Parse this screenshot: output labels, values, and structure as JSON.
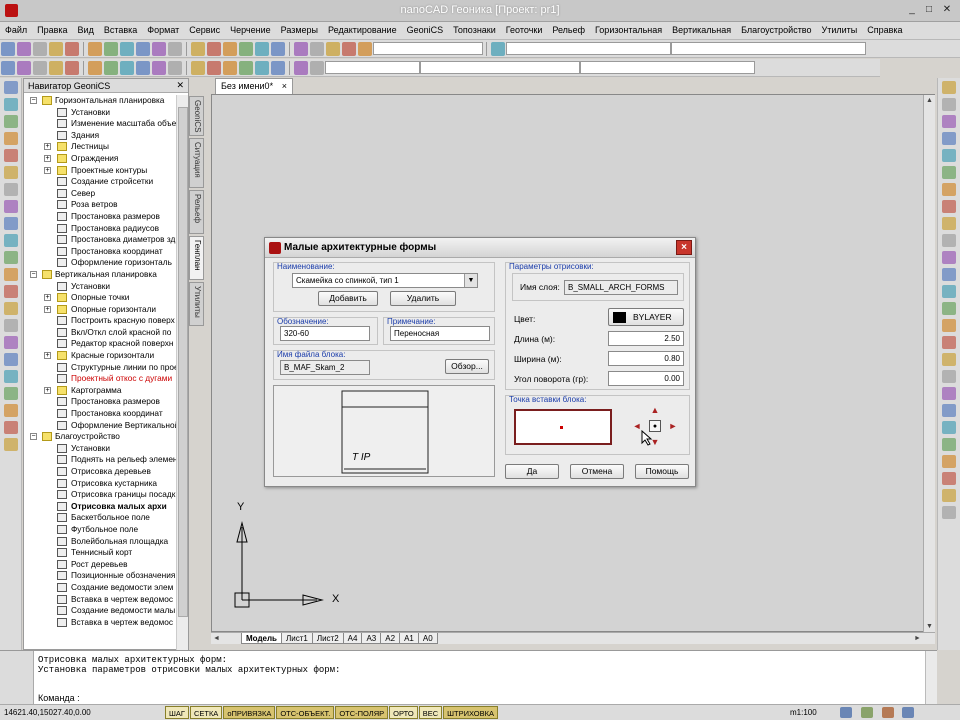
{
  "window": {
    "title": "nanoCAD Геоника [Проект: pr1]"
  },
  "menu": [
    "Файл",
    "Правка",
    "Вид",
    "Вставка",
    "Формат",
    "Сервис",
    "Черчение",
    "Размеры",
    "Редактирование",
    "GeoniCS",
    "Топознаки",
    "Геоточки",
    "Рельеф",
    "Горизонтальная",
    "Вертикальная",
    "Благоустройство",
    "Утилиты",
    "Справка"
  ],
  "navigator": {
    "title": "Навигатор GeoniCS",
    "items": [
      {
        "label": "Горизонтальная планировка",
        "level": 0,
        "expander": "−",
        "icon": "folder-icon"
      },
      {
        "label": "Установки",
        "level": 1,
        "icon": "settings-icon"
      },
      {
        "label": "Изменение масштаба объе",
        "level": 1,
        "icon": "scale-icon"
      },
      {
        "label": "Здания",
        "level": 1,
        "icon": "building-icon"
      },
      {
        "label": "Лестницы",
        "level": 1,
        "expander": "+",
        "icon": "folder-icon"
      },
      {
        "label": "Ограждения",
        "level": 1,
        "expander": "+",
        "icon": "folder-icon"
      },
      {
        "label": "Проектные контуры",
        "level": 1,
        "expander": "+",
        "icon": "folder-icon"
      },
      {
        "label": "Создание стройсетки",
        "level": 1,
        "icon": "grid-icon"
      },
      {
        "label": "Север",
        "level": 1,
        "icon": "north-icon"
      },
      {
        "label": "Роза ветров",
        "level": 1,
        "icon": "wind-rose-icon"
      },
      {
        "label": "Простановка размеров",
        "level": 1,
        "icon": "dimension-icon"
      },
      {
        "label": "Простановка радиусов",
        "level": 1,
        "icon": "radius-icon"
      },
      {
        "label": "Простановка диаметров зд",
        "level": 1,
        "icon": "diameter-icon"
      },
      {
        "label": "Простановка координат",
        "level": 1,
        "icon": "coordinate-icon"
      },
      {
        "label": "Оформление горизонталь",
        "level": 1,
        "icon": "format-icon"
      },
      {
        "label": "Вертикальная планировка",
        "level": 0,
        "expander": "−",
        "icon": "folder-icon"
      },
      {
        "label": "Установки",
        "level": 1,
        "icon": "settings-icon"
      },
      {
        "label": "Опорные точки",
        "level": 1,
        "expander": "+",
        "icon": "folder-icon"
      },
      {
        "label": "Опорные горизонтали",
        "level": 1,
        "expander": "+",
        "icon": "folder-icon"
      },
      {
        "label": "Построить красную поверх",
        "level": 1,
        "icon": "surface-icon"
      },
      {
        "label": "Вкл/Откл слой красной по",
        "level": 1,
        "icon": "layer-icon"
      },
      {
        "label": "Редактор красной поверхн",
        "level": 1,
        "icon": "editor-icon"
      },
      {
        "label": "Красные горизонтали",
        "level": 1,
        "expander": "+",
        "icon": "folder-icon"
      },
      {
        "label": "Структурные линии по прое",
        "level": 1,
        "icon": "structure-icon"
      },
      {
        "label": "Проектный откос с дугами",
        "level": 1,
        "icon": "slope-icon",
        "red": true
      },
      {
        "label": "Картограмма",
        "level": 1,
        "expander": "+",
        "icon": "folder-icon"
      },
      {
        "label": "Простановка размеров",
        "level": 1,
        "icon": "dimension-icon"
      },
      {
        "label": "Простановка координат",
        "level": 1,
        "icon": "coordinate-icon"
      },
      {
        "label": "Оформление Вертикальной",
        "level": 1,
        "icon": "format-icon"
      },
      {
        "label": "Благоустройство",
        "level": 0,
        "expander": "−",
        "icon": "folder-icon"
      },
      {
        "label": "Установки",
        "level": 1,
        "icon": "settings-icon"
      },
      {
        "label": "Поднять на рельеф элемен",
        "level": 1,
        "icon": "lift-icon"
      },
      {
        "label": "Отрисовка деревьев",
        "level": 1,
        "icon": "tree-icon"
      },
      {
        "label": "Отрисовка кустарника",
        "level": 1,
        "icon": "bush-icon"
      },
      {
        "label": "Отрисовка границы посадк",
        "level": 1,
        "icon": "border-icon"
      },
      {
        "label": "Отрисовка малых архи",
        "level": 1,
        "icon": "bench-icon",
        "bold": true
      },
      {
        "label": "Баскетбольное поле",
        "level": 1,
        "icon": "field-icon"
      },
      {
        "label": "Футбольное поле",
        "level": 1,
        "icon": "field-icon"
      },
      {
        "label": "Волейбольная площадка",
        "level": 1,
        "icon": "field-icon"
      },
      {
        "label": "Теннисный корт",
        "level": 1,
        "icon": "field-icon"
      },
      {
        "label": "Рост деревьев",
        "level": 1,
        "icon": "tree-icon"
      },
      {
        "label": "Позиционные обозначения",
        "level": 1,
        "icon": "position-icon"
      },
      {
        "label": "Создание ведомости элем",
        "level": 1,
        "icon": "table-icon"
      },
      {
        "label": "Вставка в чертеж ведомос",
        "level": 1,
        "icon": "table-icon"
      },
      {
        "label": "Создание ведомости малы",
        "level": 1,
        "icon": "table-icon"
      },
      {
        "label": "Вставка в чертеж ведомос",
        "level": 1,
        "icon": "table-icon"
      }
    ]
  },
  "side_tabs": [
    "GeoniCS",
    "Ситуация",
    "Рельеф",
    "Генплан",
    "Утилиты"
  ],
  "doc_tab": {
    "label": "Без имени0*",
    "close": "×"
  },
  "layout_tabs": [
    "Модель",
    "Лист1",
    "Лист2",
    "A4",
    "A3",
    "A2",
    "A1",
    "A0"
  ],
  "ucs": {
    "x": "X",
    "y": "Y"
  },
  "dialog": {
    "title": "Малые архитектурные формы",
    "close": "×",
    "name_group": "Наименование:",
    "name_value": "Скамейка со спинкой, тип 1",
    "add_label": "Добавить",
    "delete_label": "Удалить",
    "designation_group": "Обозначение:",
    "designation_value": "320-60",
    "note_group": "Примечание:",
    "note_value": "Переносная",
    "file_group": "Имя файла блока:",
    "file_value": "B_MAF_Skam_2",
    "browse_label": "Обзор...",
    "preview_text": "T IP",
    "params_group": "Параметры отрисовки:",
    "layer_label": "Имя слоя:",
    "layer_value": "B_SMALL_ARCH_FORMS",
    "color_label": "Цвет:",
    "color_value": "BYLAYER",
    "length_label": "Длина (м):",
    "length_value": "2.50",
    "width_label": "Ширина (м):",
    "width_value": "0.80",
    "angle_label": "Угол поворота (гр):",
    "angle_value": "0.00",
    "insert_group": "Точка вставки блока:",
    "ok_label": "Да",
    "cancel_label": "Отмена",
    "help_label": "Помощь"
  },
  "command": {
    "history": [
      "Отрисовка малых архитектурных форм:",
      "Установка параметров отрисовки малых архитектурных форм:"
    ],
    "prompt": "Команда :"
  },
  "status": {
    "coords": "14621.40,15027.40,0.00",
    "snaps": [
      {
        "label": "ШАГ",
        "on": false
      },
      {
        "label": "СЕТКА",
        "on": false
      },
      {
        "label": "оПРИВЯЗКА",
        "on": true
      },
      {
        "label": "ОТС-ОБЪЕКТ.",
        "on": true
      },
      {
        "label": "ОТС-ПОЛЯР",
        "on": true
      },
      {
        "label": "ОРТО",
        "on": false
      },
      {
        "label": "ВЕС",
        "on": false
      },
      {
        "label": "ШТРИХОВКА",
        "on": true
      }
    ],
    "scale": "m1:100"
  },
  "colors": {
    "accent_red": "#c8352b",
    "snap_on": "#d7c36f",
    "snap_off": "#efe7b8",
    "group_label": "#1a3caa"
  }
}
